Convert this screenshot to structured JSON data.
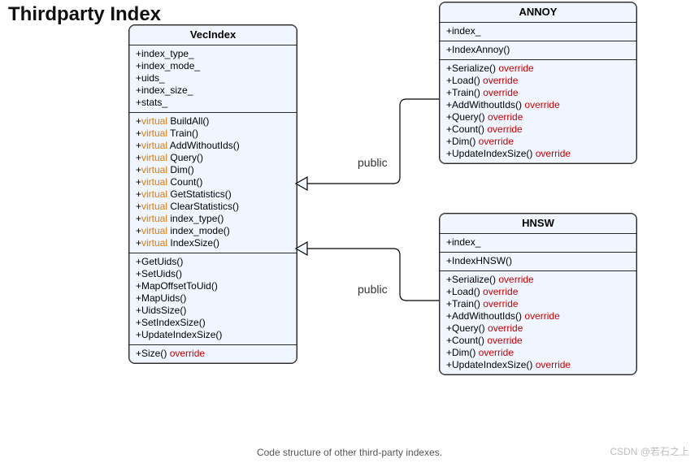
{
  "title": "Thirdparty Index",
  "caption": "Code structure of other third-party indexes.",
  "watermark": "CSDN @若石之上",
  "rel": {
    "annoy": "public",
    "hnsw": "public"
  },
  "classes": {
    "vecindex": {
      "name": "VecIndex",
      "fields": [
        {
          "sig": "+index_type_"
        },
        {
          "sig": "+index_mode_"
        },
        {
          "sig": "+uids_"
        },
        {
          "sig": "+index_size_"
        },
        {
          "sig": "+stats_"
        }
      ],
      "virtuals": [
        {
          "sig": "BuildAll()"
        },
        {
          "sig": "Train()"
        },
        {
          "sig": "AddWithoutIds()"
        },
        {
          "sig": "Query()"
        },
        {
          "sig": "Dim()"
        },
        {
          "sig": "Count()"
        },
        {
          "sig": "GetStatistics()"
        },
        {
          "sig": "ClearStatistics()"
        },
        {
          "sig": "index_type()"
        },
        {
          "sig": "index_mode()"
        },
        {
          "sig": "IndexSize()"
        }
      ],
      "plain": [
        {
          "sig": "+GetUids()"
        },
        {
          "sig": "+SetUids()"
        },
        {
          "sig": "+MapOffsetToUid()"
        },
        {
          "sig": "+MapUids()"
        },
        {
          "sig": "+UidsSize()"
        },
        {
          "sig": "+SetIndexSize()"
        },
        {
          "sig": "+UpdateIndexSize()"
        }
      ],
      "trailer": [
        {
          "sig": "+Size()",
          "override": true
        }
      ]
    },
    "annoy": {
      "name": "ANNOY",
      "fields": [
        {
          "sig": "+index_"
        }
      ],
      "ctors": [
        {
          "sig": "+IndexAnnoy()"
        }
      ],
      "overrides": [
        {
          "sig": "+Serialize()",
          "override": true
        },
        {
          "sig": "+Load()",
          "override": true
        },
        {
          "sig": "+Train()",
          "override": true
        },
        {
          "sig": "+AddWithoutIds()",
          "override": true
        },
        {
          "sig": "+Query()",
          "override": true
        },
        {
          "sig": "+Count()",
          "override": true
        },
        {
          "sig": "+Dim()",
          "override": true
        },
        {
          "sig": "+UpdateIndexSize()",
          "override": true
        }
      ]
    },
    "hnsw": {
      "name": "HNSW",
      "fields": [
        {
          "sig": "+index_"
        }
      ],
      "ctors": [
        {
          "sig": "+IndexHNSW()"
        }
      ],
      "overrides": [
        {
          "sig": "+Serialize()",
          "override": true
        },
        {
          "sig": "+Load()",
          "override": true
        },
        {
          "sig": "+Train()",
          "override": true
        },
        {
          "sig": "+AddWithoutIds()",
          "override": true
        },
        {
          "sig": "+Query()",
          "override": true
        },
        {
          "sig": "+Count()",
          "override": true
        },
        {
          "sig": "+Dim()",
          "override": true
        },
        {
          "sig": "+UpdateIndexSize()",
          "override": true
        }
      ]
    }
  }
}
